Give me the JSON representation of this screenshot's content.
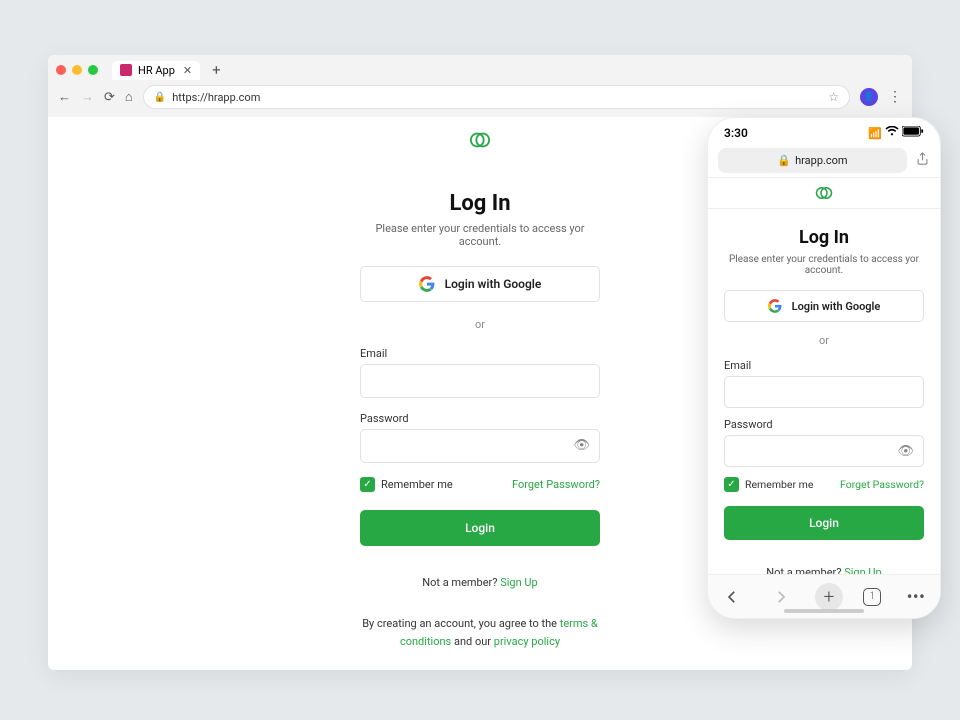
{
  "browser": {
    "tab_name": "HR App",
    "url": "https://hrapp.com"
  },
  "page": {
    "title": "Log In",
    "subtitle": "Please enter your credentials to access yor account.",
    "google_button": "Login with Google",
    "or": "or",
    "email_label": "Email",
    "password_label": "Password",
    "remember_label": "Remember me",
    "forgot_label": "Forget Password?",
    "login_button": "Login",
    "not_member_prefix": "Not a member? ",
    "signup": "Sign Up",
    "legal_prefix": "By creating an account, you agree to the ",
    "terms": "terms & conditions",
    "legal_mid": " and our ",
    "privacy": "privacy policy"
  },
  "phone": {
    "time": "3:30",
    "url": "hrapp.com",
    "tabs_count": "1"
  },
  "colors": {
    "accent": "#28a745"
  }
}
